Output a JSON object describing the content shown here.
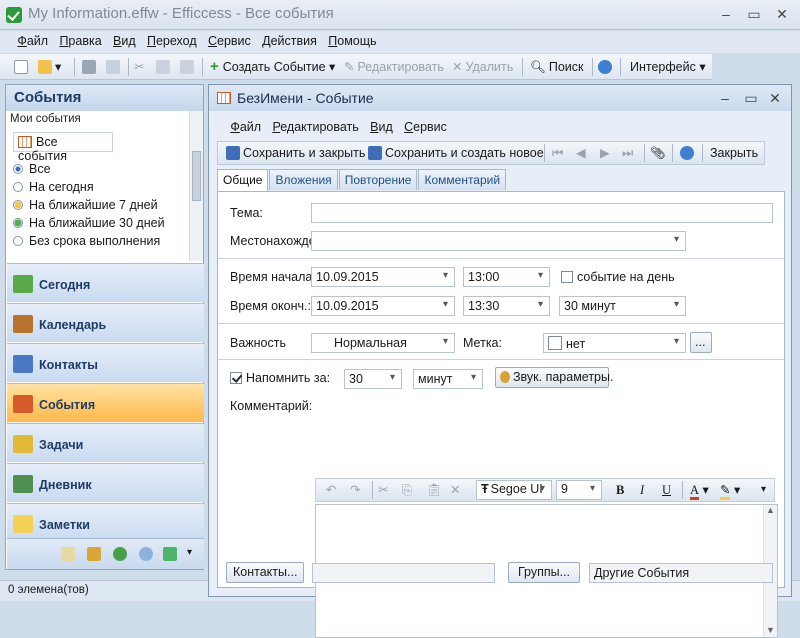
{
  "window": {
    "title": "My Information.effw - Efficcess - Все события"
  },
  "menu": [
    "Файл",
    "Правка",
    "Вид",
    "Переход",
    "Сервис",
    "Действия",
    "Помощь"
  ],
  "toolbar": {
    "create_event": "Создать Событие",
    "edit": "Редактировать",
    "delete": "Удалить",
    "search": "Поиск",
    "interface": "Интерфейс"
  },
  "sidebar": {
    "header": "События",
    "my_events": "Мои события",
    "all_events": "Все события",
    "filters": [
      "Все",
      "На сегодня",
      "На ближайшие 7 дней",
      "На ближайшие 30 дней",
      "Без срока выполнения"
    ],
    "nav": [
      "Сегодня",
      "Календарь",
      "Контакты",
      "События",
      "Задачи",
      "Дневник",
      "Заметки"
    ]
  },
  "status": "0 элемена(тов)",
  "event_window": {
    "title": "БезИмени - Событие",
    "menu": [
      "Файл",
      "Редактировать",
      "Вид",
      "Сервис"
    ],
    "toolbar": {
      "save_close": "Сохранить и закрыть",
      "save_new": "Сохранить и создать новое",
      "close": "Закрыть"
    },
    "tabs": [
      "Общие",
      "Вложения",
      "Повторение",
      "Комментарий"
    ],
    "form": {
      "subject_label": "Тема:",
      "subject_value": "",
      "location_label": "Местонахожде",
      "location_value": "",
      "start_label": "Время начала:",
      "start_date": "10.09.2015",
      "start_time": "13:00",
      "all_day_label": "событие на день",
      "end_label": "Время оконч.:",
      "end_date": "10.09.2015",
      "end_time": "13:30",
      "duration": "30 минут",
      "importance_label": "Важность",
      "importance_value": "Нормальная",
      "tag_label": "Метка:",
      "tag_value": "нет",
      "tag_more": "...",
      "remind_label": "Напомнить за:",
      "remind_value": "30",
      "remind_unit": "минут",
      "sound_button": "Звук. параметры.",
      "comment_label": "Комментарий:",
      "font_name": "Segoe UI",
      "font_size": "9",
      "bold": "B",
      "italic": "I",
      "underline": "U",
      "contacts_button": "Контакты...",
      "contacts_value": "",
      "groups_button": "Группы...",
      "groups_value": "Другие События"
    }
  }
}
